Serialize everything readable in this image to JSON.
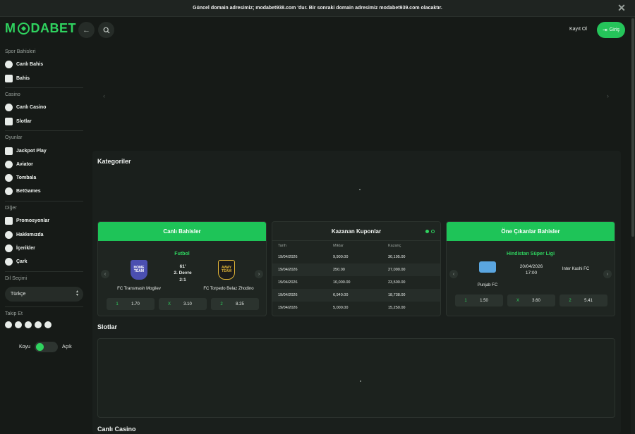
{
  "announcement": {
    "text": "Güncel domain adresimiz; modabet938.com 'dur. Bir sonraki domain adresimiz modabet939.com olacaktır."
  },
  "header": {
    "logo_left": "M",
    "logo_right": "DABET",
    "register_label": "Kayıt Ol",
    "login_label": "Giriş"
  },
  "sidebar": {
    "sections": [
      {
        "title": "Spor Bahisleri",
        "items": [
          "Canlı Bahis",
          "Bahis"
        ]
      },
      {
        "title": "Casino",
        "items": [
          "Canlı Casino",
          "Slotlar"
        ]
      },
      {
        "title": "Oyunlar",
        "items": [
          "Jackpot Play",
          "Aviator",
          "Tombala",
          "BetGames"
        ]
      },
      {
        "title": "Diğer",
        "items": [
          "Promosyonlar",
          "Hakkımızda",
          "İçerikler",
          "Çark"
        ]
      }
    ],
    "language_title": "Dil Seçimi",
    "language_value": "Türkçe",
    "follow_title": "Takip Et",
    "theme_dark": "Koyu",
    "theme_light": "Açık"
  },
  "main": {
    "categories_title": "Kategoriler",
    "slots_title": "Slotlar",
    "live_casino_title": "Canlı Casino"
  },
  "live_card": {
    "title": "Canlı Bahisler",
    "league": "Futbol",
    "home_crest": "HOME TEAM",
    "away_crest": "AWAY TEAM",
    "minute": "61'",
    "period": "2. Devre",
    "score": "2:1",
    "home": "FC Transmash Mogilev",
    "away": "FC Torpedo Belaz Zhodino",
    "odds": [
      {
        "k": "1",
        "v": "1.70"
      },
      {
        "k": "X",
        "v": "3.10"
      },
      {
        "k": "2",
        "v": "8.25"
      }
    ]
  },
  "coupon_card": {
    "title": "Kazanan Kuponlar",
    "headers": [
      "Tarih",
      "Miktar",
      "Kazanç"
    ],
    "rows": [
      [
        "19/04/2026",
        "9,900.00",
        "30,195.00"
      ],
      [
        "19/04/2026",
        "250.00",
        "27,090.00"
      ],
      [
        "19/04/2026",
        "10,000.00",
        "23,500.00"
      ],
      [
        "19/04/2026",
        "6,940.00",
        "18,738.00"
      ],
      [
        "19/04/2026",
        "5,000.00",
        "15,250.00"
      ]
    ]
  },
  "featured_card": {
    "title": "Öne Çıkanlar Bahisler",
    "league": "Hindistan Süper Ligi",
    "date": "20/04/2026",
    "time": "17:00",
    "home": "Punjab FC",
    "away": "Inter Kashi FC",
    "odds": [
      {
        "k": "1",
        "v": "1.50"
      },
      {
        "k": "X",
        "v": "3.60"
      },
      {
        "k": "2",
        "v": "5.41"
      }
    ]
  },
  "colors": {
    "accent": "#1ec458",
    "background": "#161a17",
    "panel": "#1f2521"
  }
}
